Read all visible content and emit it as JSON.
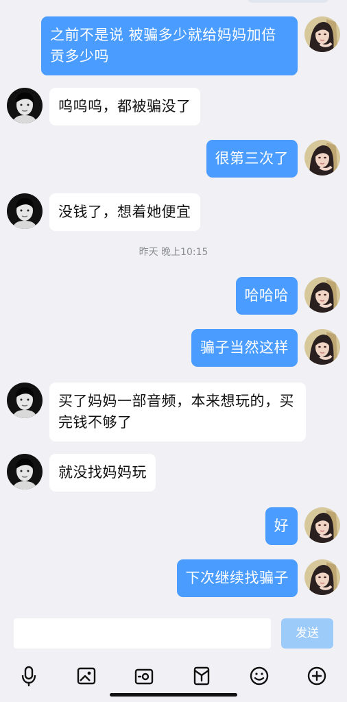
{
  "timestamp": "昨天 晚上10:15",
  "messages": [
    {
      "side": "right",
      "text": "之前不是说 被骗多少就给妈妈加倍贡多少吗"
    },
    {
      "side": "left",
      "text": "呜呜呜，都被骗没了"
    },
    {
      "side": "right",
      "text": "很第三次了"
    },
    {
      "side": "left",
      "text": "没钱了，想着她便宜"
    },
    {
      "side": "right",
      "text": "哈哈哈"
    },
    {
      "side": "right",
      "text": "骗子当然这样"
    },
    {
      "side": "left",
      "text": "买了妈妈一部音频，本来想玩的，买完钱不够了"
    },
    {
      "side": "left",
      "text": "就没找妈妈玩"
    },
    {
      "side": "right",
      "text": "好"
    },
    {
      "side": "right",
      "text": "下次继续找骗子"
    }
  ],
  "composer": {
    "input_value": "",
    "input_placeholder": "",
    "send_label": "发送"
  },
  "toolbar": {
    "icons": [
      "microphone-icon",
      "image-icon",
      "camera-icon",
      "red-packet-icon",
      "emoji-icon",
      "plus-icon"
    ]
  },
  "colors": {
    "background": "#f1f1f5",
    "outgoing_bubble": "#4a9cff",
    "incoming_bubble": "#ffffff",
    "send_button_disabled": "#9ccaf9"
  }
}
